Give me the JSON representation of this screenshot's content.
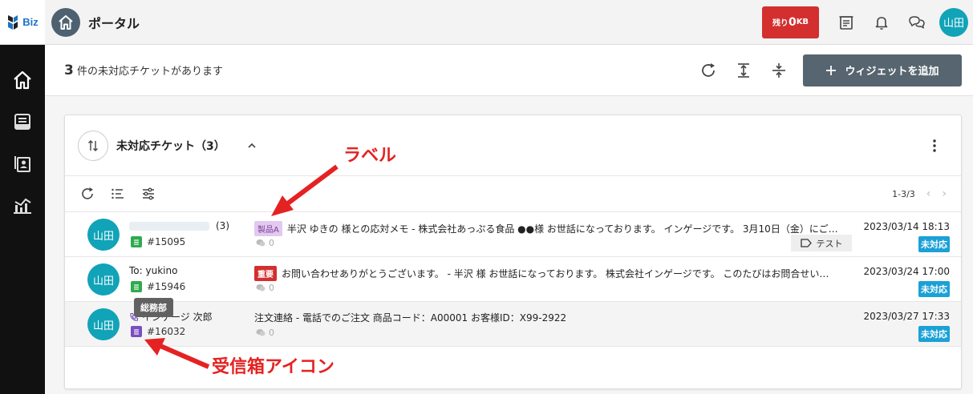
{
  "app": {
    "logo_text": "Biz"
  },
  "topbar": {
    "title": "ポータル",
    "remaining_prefix": "残り",
    "remaining_value": "0",
    "remaining_unit": "KB",
    "user_avatar": "山田",
    "icons": [
      "inbox-tray-icon",
      "bell-icon",
      "chat-icon"
    ]
  },
  "subheader": {
    "count": "3",
    "count_text": "件の未対応チケットがあります",
    "add_widget_label": "ウィジェットを追加"
  },
  "widget": {
    "title": "未対応チケット（3）",
    "pager_text": "1-3/3"
  },
  "rows": [
    {
      "avatar": "山田",
      "sender_suffix": "(3)",
      "ticket": "#15095",
      "label": "製品A",
      "subject": "半沢 ゆきの 様との応対メモ - 株式会社あっぷる食品 ●●様 お世話になっております。 インゲージです。 3月10日（金）にご…",
      "comments": "0",
      "tag": "テスト",
      "date": "2023/03/14 18:13",
      "status": "未対応"
    },
    {
      "avatar": "山田",
      "sender": "To: yukino",
      "ticket": "#15946",
      "label": "重要",
      "subject": "お問い合わせありがとうございます。 - 半沢 様 お世話になっております。 株式会社インゲージです。 このたびはお問合せい…",
      "comments": "0",
      "date": "2023/03/24 17:00",
      "status": "未対応"
    },
    {
      "avatar": "山田",
      "sender": "インゲージ 次郎",
      "ticket": "#16032",
      "subject": "注文連絡 - 電話でのご注文 商品コード：A00001 お客様ID：X99-2922",
      "comments": "0",
      "date": "2023/03/27 17:33",
      "status": "未対応"
    }
  ],
  "tooltip": "総務部",
  "annotations": {
    "label_note": "ラベル",
    "inbox_note": "受信箱アイコン"
  },
  "colors": {
    "accent_red": "#d32f2f",
    "teal_avatar": "#11a3b8",
    "status_blue": "#1ba1d6",
    "annotation_red": "#e52222"
  }
}
